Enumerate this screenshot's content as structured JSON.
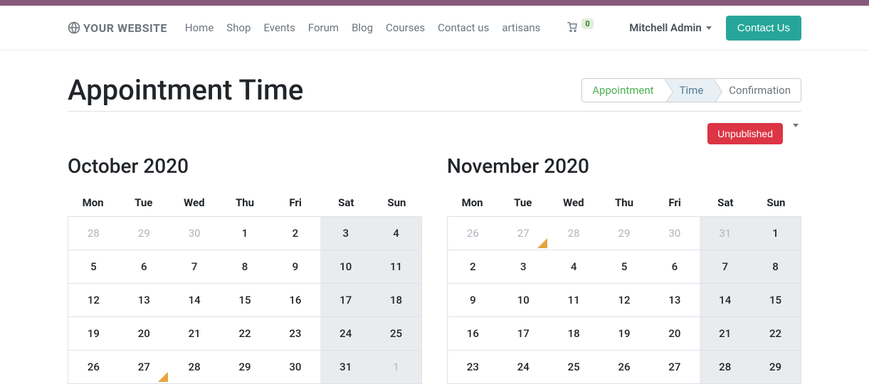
{
  "brand": "YOUR WEBSITE",
  "nav": {
    "home": "Home",
    "shop": "Shop",
    "events": "Events",
    "forum": "Forum",
    "blog": "Blog",
    "courses": "Courses",
    "contact": "Contact us",
    "artisans": "artisans"
  },
  "cart_count": "0",
  "user_name": "Mitchell Admin",
  "contact_btn": "Contact Us",
  "page_title": "Appointment Time",
  "wizard": {
    "step1": "Appointment",
    "step2": "Time",
    "step3": "Confirmation"
  },
  "publish_label": "Unpublished",
  "dow": {
    "mon": "Mon",
    "tue": "Tue",
    "wed": "Wed",
    "thu": "Thu",
    "fri": "Fri",
    "sat": "Sat",
    "sun": "Sun"
  },
  "cal1": {
    "title": "October 2020",
    "r0": {
      "c0": "28",
      "c1": "29",
      "c2": "30",
      "c3": "1",
      "c4": "2",
      "c5": "3",
      "c6": "4"
    },
    "r1": {
      "c0": "5",
      "c1": "6",
      "c2": "7",
      "c3": "8",
      "c4": "9",
      "c5": "10",
      "c6": "11"
    },
    "r2": {
      "c0": "12",
      "c1": "13",
      "c2": "14",
      "c3": "15",
      "c4": "16",
      "c5": "17",
      "c6": "18"
    },
    "r3": {
      "c0": "19",
      "c1": "20",
      "c2": "21",
      "c3": "22",
      "c4": "23",
      "c5": "24",
      "c6": "25"
    },
    "r4": {
      "c0": "26",
      "c1": "27",
      "c2": "28",
      "c3": "29",
      "c4": "30",
      "c5": "31",
      "c6": "1"
    }
  },
  "cal2": {
    "title": "November 2020",
    "r0": {
      "c0": "26",
      "c1": "27",
      "c2": "28",
      "c3": "29",
      "c4": "30",
      "c5": "31",
      "c6": "1"
    },
    "r1": {
      "c0": "2",
      "c1": "3",
      "c2": "4",
      "c3": "5",
      "c4": "6",
      "c5": "7",
      "c6": "8"
    },
    "r2": {
      "c0": "9",
      "c1": "10",
      "c2": "11",
      "c3": "12",
      "c4": "13",
      "c5": "14",
      "c6": "15"
    },
    "r3": {
      "c0": "16",
      "c1": "17",
      "c2": "18",
      "c3": "19",
      "c4": "20",
      "c5": "21",
      "c6": "22"
    },
    "r4": {
      "c0": "23",
      "c1": "24",
      "c2": "25",
      "c3": "26",
      "c4": "27",
      "c5": "28",
      "c6": "29"
    }
  }
}
